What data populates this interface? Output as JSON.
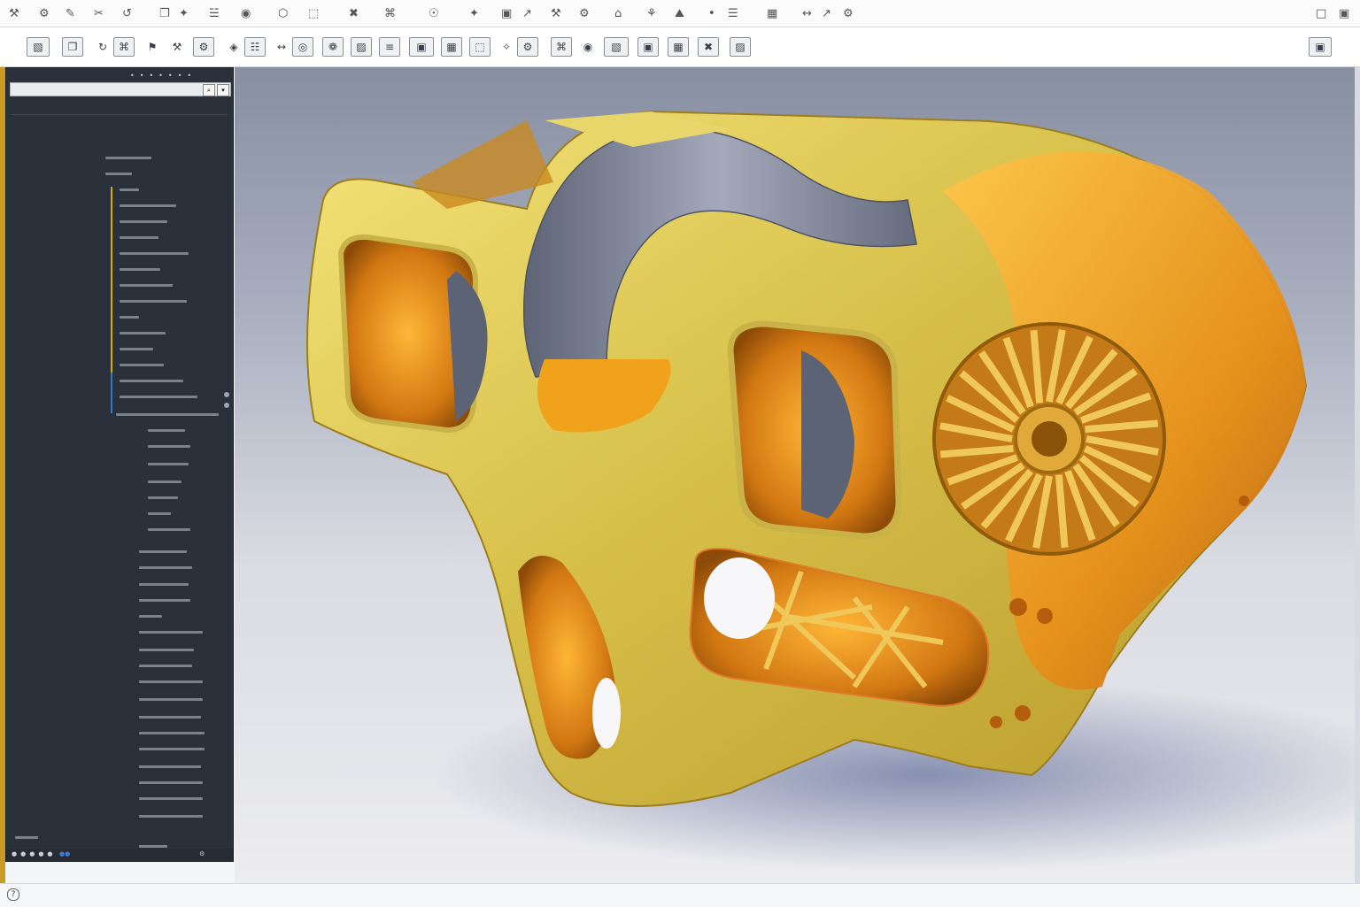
{
  "colors": {
    "panel_bg": "#2b313b",
    "accent_gold": "#d9c24a",
    "accent_orange": "#f1a21b",
    "tree_guide": "#d4a90a",
    "tree_guide_blue": "#2f7bd1"
  },
  "menu_icons": [
    "a",
    "b",
    "c",
    "d",
    "e",
    "f",
    "g",
    "h",
    "i",
    "j",
    "k",
    "l",
    "m",
    "n",
    "o",
    "p",
    "q",
    "r",
    "s",
    "t",
    "u",
    "v",
    "w",
    "x"
  ],
  "toolbar_icons": [
    "sketch-icon",
    "extrude-icon",
    "revolve-icon",
    "sweep-icon",
    "loft-icon",
    "fillet-icon",
    "chamfer-icon",
    "shell-icon",
    "pattern-icon",
    "mirror-icon",
    "hole-icon",
    "thread-icon",
    "section-icon",
    "measure-icon",
    "render-icon",
    "mesh-icon",
    "lattice-icon",
    "generative-icon",
    "simulate-icon",
    "assemble-icon",
    "joint-icon",
    "inspect-icon",
    "insert-icon",
    "select-icon"
  ],
  "panel": {
    "header": "",
    "sub_left": "",
    "sub_right": ""
  },
  "tree_items": [],
  "status": {}
}
